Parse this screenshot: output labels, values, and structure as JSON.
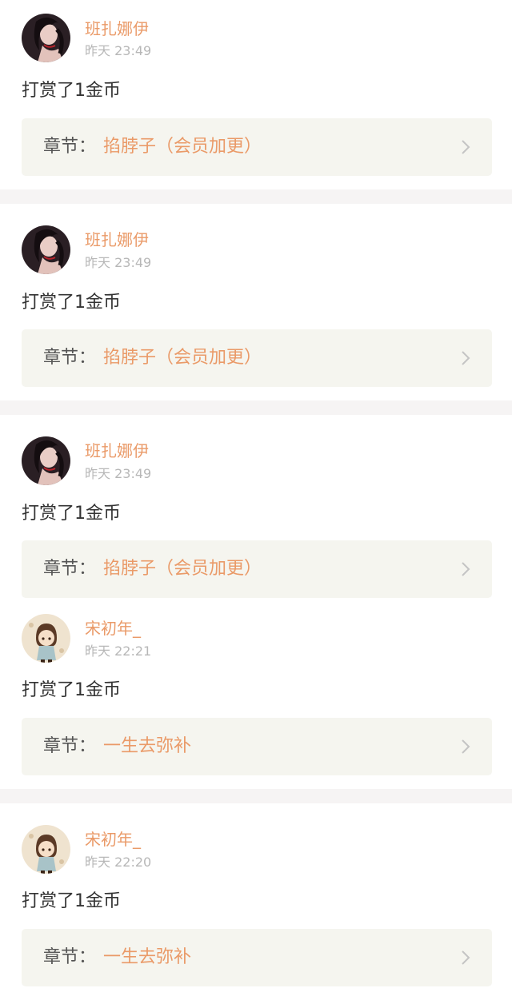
{
  "rewards": [
    {
      "user": "班扎娜伊",
      "time": "昨天 23:49",
      "action": "打赏了1金币",
      "chapter_label": "章节：",
      "chapter_title": "掐脖子（会员加更）",
      "avatar_icon": "avatar-dark-hair-girl-icon"
    },
    {
      "user": "班扎娜伊",
      "time": "昨天 23:49",
      "action": "打赏了1金币",
      "chapter_label": "章节：",
      "chapter_title": "掐脖子（会员加更）",
      "avatar_icon": "avatar-dark-hair-girl-icon"
    },
    {
      "user": "班扎娜伊",
      "time": "昨天 23:49",
      "action": "打赏了1金币",
      "chapter_label": "章节：",
      "chapter_title": "掐脖子（会员加更）",
      "avatar_icon": "avatar-dark-hair-girl-icon"
    },
    {
      "user": "宋初年_",
      "time": "昨天 22:21",
      "action": "打赏了1金币",
      "chapter_label": "章节：",
      "chapter_title": "一生去弥补",
      "avatar_icon": "avatar-chibi-boy-icon"
    },
    {
      "user": "宋初年_",
      "time": "昨天 22:20",
      "action": "打赏了1金币",
      "chapter_label": "章节：",
      "chapter_title": "一生去弥补",
      "avatar_icon": "avatar-chibi-boy-icon"
    }
  ],
  "colors": {
    "accent": "#ea9a68",
    "timestamp": "#b7b7b7",
    "card_bg": "#f5f5ef",
    "separator": "#f6f4f4"
  }
}
